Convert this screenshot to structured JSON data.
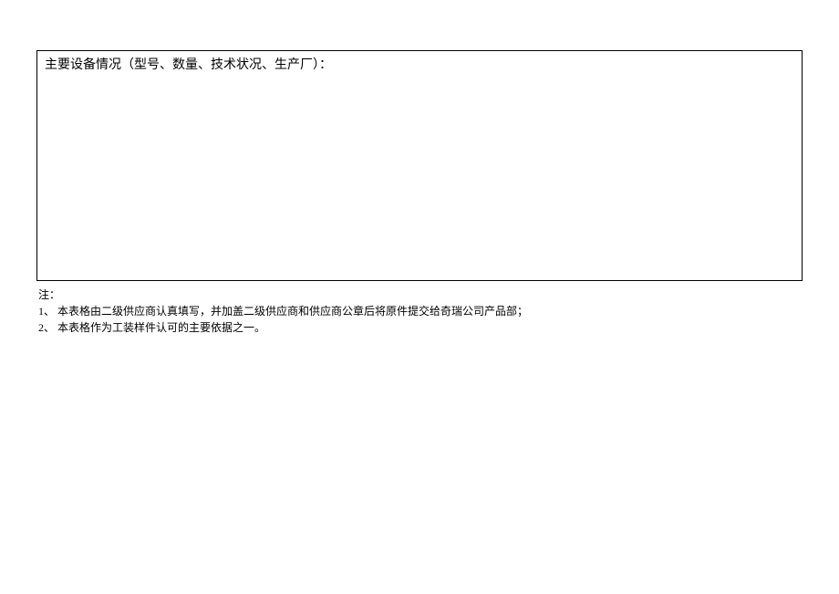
{
  "form": {
    "box_title": "主要设备情况（型号、数量、技术状况、生产厂）："
  },
  "notes": {
    "header": "注：",
    "item1": "1、 本表格由二级供应商认真填写，并加盖二级供应商和供应商公章后将原件提交给奇瑞公司产品部；",
    "item2": "2、 本表格作为工装样件认可的主要依据之一。"
  }
}
